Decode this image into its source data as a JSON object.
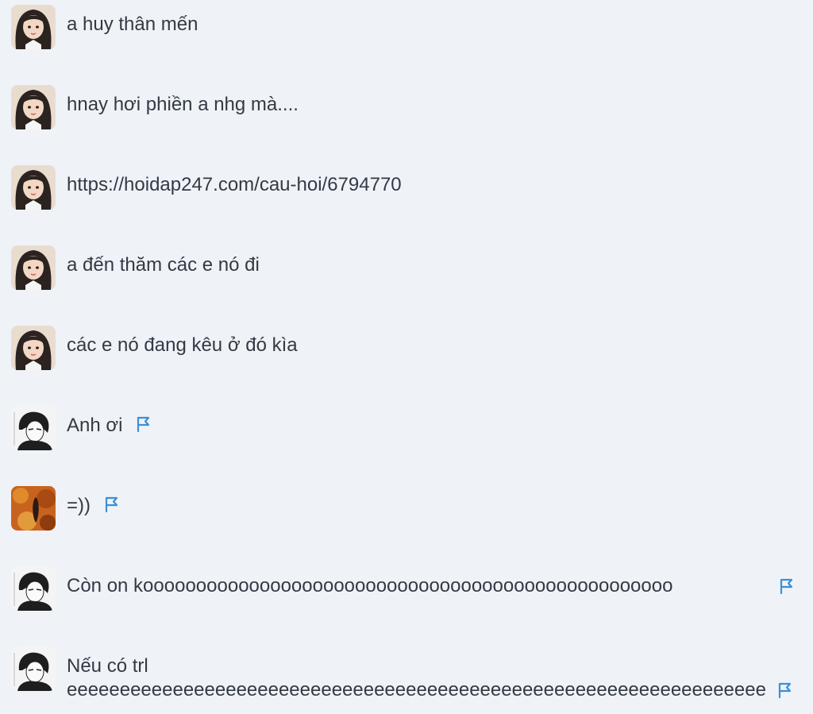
{
  "messages": [
    {
      "avatar": "avatar-girl-photo",
      "text": "a huy thân mến",
      "flag": false
    },
    {
      "avatar": "avatar-girl-photo",
      "text": "hnay hơi phiền a nhg mà....",
      "flag": false
    },
    {
      "avatar": "avatar-girl-photo",
      "text": "https://hoidap247.com/cau-hoi/6794770",
      "flag": false
    },
    {
      "avatar": "avatar-girl-photo",
      "text": "a đến thăm các e nó đi",
      "flag": false
    },
    {
      "avatar": "avatar-girl-photo",
      "text": "các e nó đang kêu ở đó kìa",
      "flag": false
    },
    {
      "avatar": "avatar-boy-manga",
      "text": "Anh ơi",
      "flag": true
    },
    {
      "avatar": "avatar-autumn-photo",
      "text": "=))",
      "flag": true
    },
    {
      "avatar": "avatar-boy-manga",
      "text": "Còn on koooooooooooooooooooooooooooooooooooooooooooooooooo",
      "flag": true
    },
    {
      "avatar": "avatar-boy-manga",
      "text_line1": "Nếu có trl",
      "text_line2": "eeeeeeeeeeeeeeeeeeeeeeeeeeeeeeeeeeeeeeeeeeeeeeeeeeeeeeeeeeeeeeeeeeeeeeeeeeeeeeeeeeeeeeeeeeeeeeeeeeeeeeeeeeeeeeeeeeeeeeee",
      "flag": true
    }
  ],
  "colors": {
    "background": "#eff3f8",
    "text": "#333a44",
    "flag": "#3d8fd6"
  },
  "icons": {
    "report": "flag-icon"
  }
}
